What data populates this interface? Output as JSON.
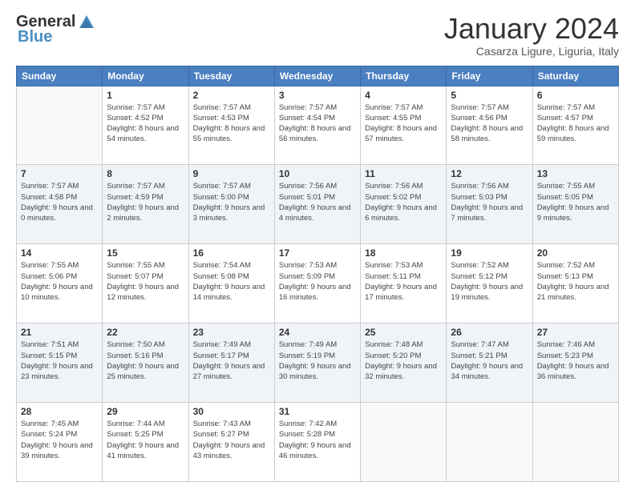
{
  "logo": {
    "general": "General",
    "blue": "Blue"
  },
  "title": "January 2024",
  "subtitle": "Casarza Ligure, Liguria, Italy",
  "weekdays": [
    "Sunday",
    "Monday",
    "Tuesday",
    "Wednesday",
    "Thursday",
    "Friday",
    "Saturday"
  ],
  "weeks": [
    [
      {
        "day": "",
        "info": ""
      },
      {
        "day": "1",
        "info": "Sunrise: 7:57 AM\nSunset: 4:52 PM\nDaylight: 8 hours\nand 54 minutes."
      },
      {
        "day": "2",
        "info": "Sunrise: 7:57 AM\nSunset: 4:53 PM\nDaylight: 8 hours\nand 55 minutes."
      },
      {
        "day": "3",
        "info": "Sunrise: 7:57 AM\nSunset: 4:54 PM\nDaylight: 8 hours\nand 56 minutes."
      },
      {
        "day": "4",
        "info": "Sunrise: 7:57 AM\nSunset: 4:55 PM\nDaylight: 8 hours\nand 57 minutes."
      },
      {
        "day": "5",
        "info": "Sunrise: 7:57 AM\nSunset: 4:56 PM\nDaylight: 8 hours\nand 58 minutes."
      },
      {
        "day": "6",
        "info": "Sunrise: 7:57 AM\nSunset: 4:57 PM\nDaylight: 8 hours\nand 59 minutes."
      }
    ],
    [
      {
        "day": "7",
        "info": "Sunrise: 7:57 AM\nSunset: 4:58 PM\nDaylight: 9 hours\nand 0 minutes."
      },
      {
        "day": "8",
        "info": "Sunrise: 7:57 AM\nSunset: 4:59 PM\nDaylight: 9 hours\nand 2 minutes."
      },
      {
        "day": "9",
        "info": "Sunrise: 7:57 AM\nSunset: 5:00 PM\nDaylight: 9 hours\nand 3 minutes."
      },
      {
        "day": "10",
        "info": "Sunrise: 7:56 AM\nSunset: 5:01 PM\nDaylight: 9 hours\nand 4 minutes."
      },
      {
        "day": "11",
        "info": "Sunrise: 7:56 AM\nSunset: 5:02 PM\nDaylight: 9 hours\nand 6 minutes."
      },
      {
        "day": "12",
        "info": "Sunrise: 7:56 AM\nSunset: 5:03 PM\nDaylight: 9 hours\nand 7 minutes."
      },
      {
        "day": "13",
        "info": "Sunrise: 7:55 AM\nSunset: 5:05 PM\nDaylight: 9 hours\nand 9 minutes."
      }
    ],
    [
      {
        "day": "14",
        "info": "Sunrise: 7:55 AM\nSunset: 5:06 PM\nDaylight: 9 hours\nand 10 minutes."
      },
      {
        "day": "15",
        "info": "Sunrise: 7:55 AM\nSunset: 5:07 PM\nDaylight: 9 hours\nand 12 minutes."
      },
      {
        "day": "16",
        "info": "Sunrise: 7:54 AM\nSunset: 5:08 PM\nDaylight: 9 hours\nand 14 minutes."
      },
      {
        "day": "17",
        "info": "Sunrise: 7:53 AM\nSunset: 5:09 PM\nDaylight: 9 hours\nand 16 minutes."
      },
      {
        "day": "18",
        "info": "Sunrise: 7:53 AM\nSunset: 5:11 PM\nDaylight: 9 hours\nand 17 minutes."
      },
      {
        "day": "19",
        "info": "Sunrise: 7:52 AM\nSunset: 5:12 PM\nDaylight: 9 hours\nand 19 minutes."
      },
      {
        "day": "20",
        "info": "Sunrise: 7:52 AM\nSunset: 5:13 PM\nDaylight: 9 hours\nand 21 minutes."
      }
    ],
    [
      {
        "day": "21",
        "info": "Sunrise: 7:51 AM\nSunset: 5:15 PM\nDaylight: 9 hours\nand 23 minutes."
      },
      {
        "day": "22",
        "info": "Sunrise: 7:50 AM\nSunset: 5:16 PM\nDaylight: 9 hours\nand 25 minutes."
      },
      {
        "day": "23",
        "info": "Sunrise: 7:49 AM\nSunset: 5:17 PM\nDaylight: 9 hours\nand 27 minutes."
      },
      {
        "day": "24",
        "info": "Sunrise: 7:49 AM\nSunset: 5:19 PM\nDaylight: 9 hours\nand 30 minutes."
      },
      {
        "day": "25",
        "info": "Sunrise: 7:48 AM\nSunset: 5:20 PM\nDaylight: 9 hours\nand 32 minutes."
      },
      {
        "day": "26",
        "info": "Sunrise: 7:47 AM\nSunset: 5:21 PM\nDaylight: 9 hours\nand 34 minutes."
      },
      {
        "day": "27",
        "info": "Sunrise: 7:46 AM\nSunset: 5:23 PM\nDaylight: 9 hours\nand 36 minutes."
      }
    ],
    [
      {
        "day": "28",
        "info": "Sunrise: 7:45 AM\nSunset: 5:24 PM\nDaylight: 9 hours\nand 39 minutes."
      },
      {
        "day": "29",
        "info": "Sunrise: 7:44 AM\nSunset: 5:25 PM\nDaylight: 9 hours\nand 41 minutes."
      },
      {
        "day": "30",
        "info": "Sunrise: 7:43 AM\nSunset: 5:27 PM\nDaylight: 9 hours\nand 43 minutes."
      },
      {
        "day": "31",
        "info": "Sunrise: 7:42 AM\nSunset: 5:28 PM\nDaylight: 9 hours\nand 46 minutes."
      },
      {
        "day": "",
        "info": ""
      },
      {
        "day": "",
        "info": ""
      },
      {
        "day": "",
        "info": ""
      }
    ]
  ]
}
